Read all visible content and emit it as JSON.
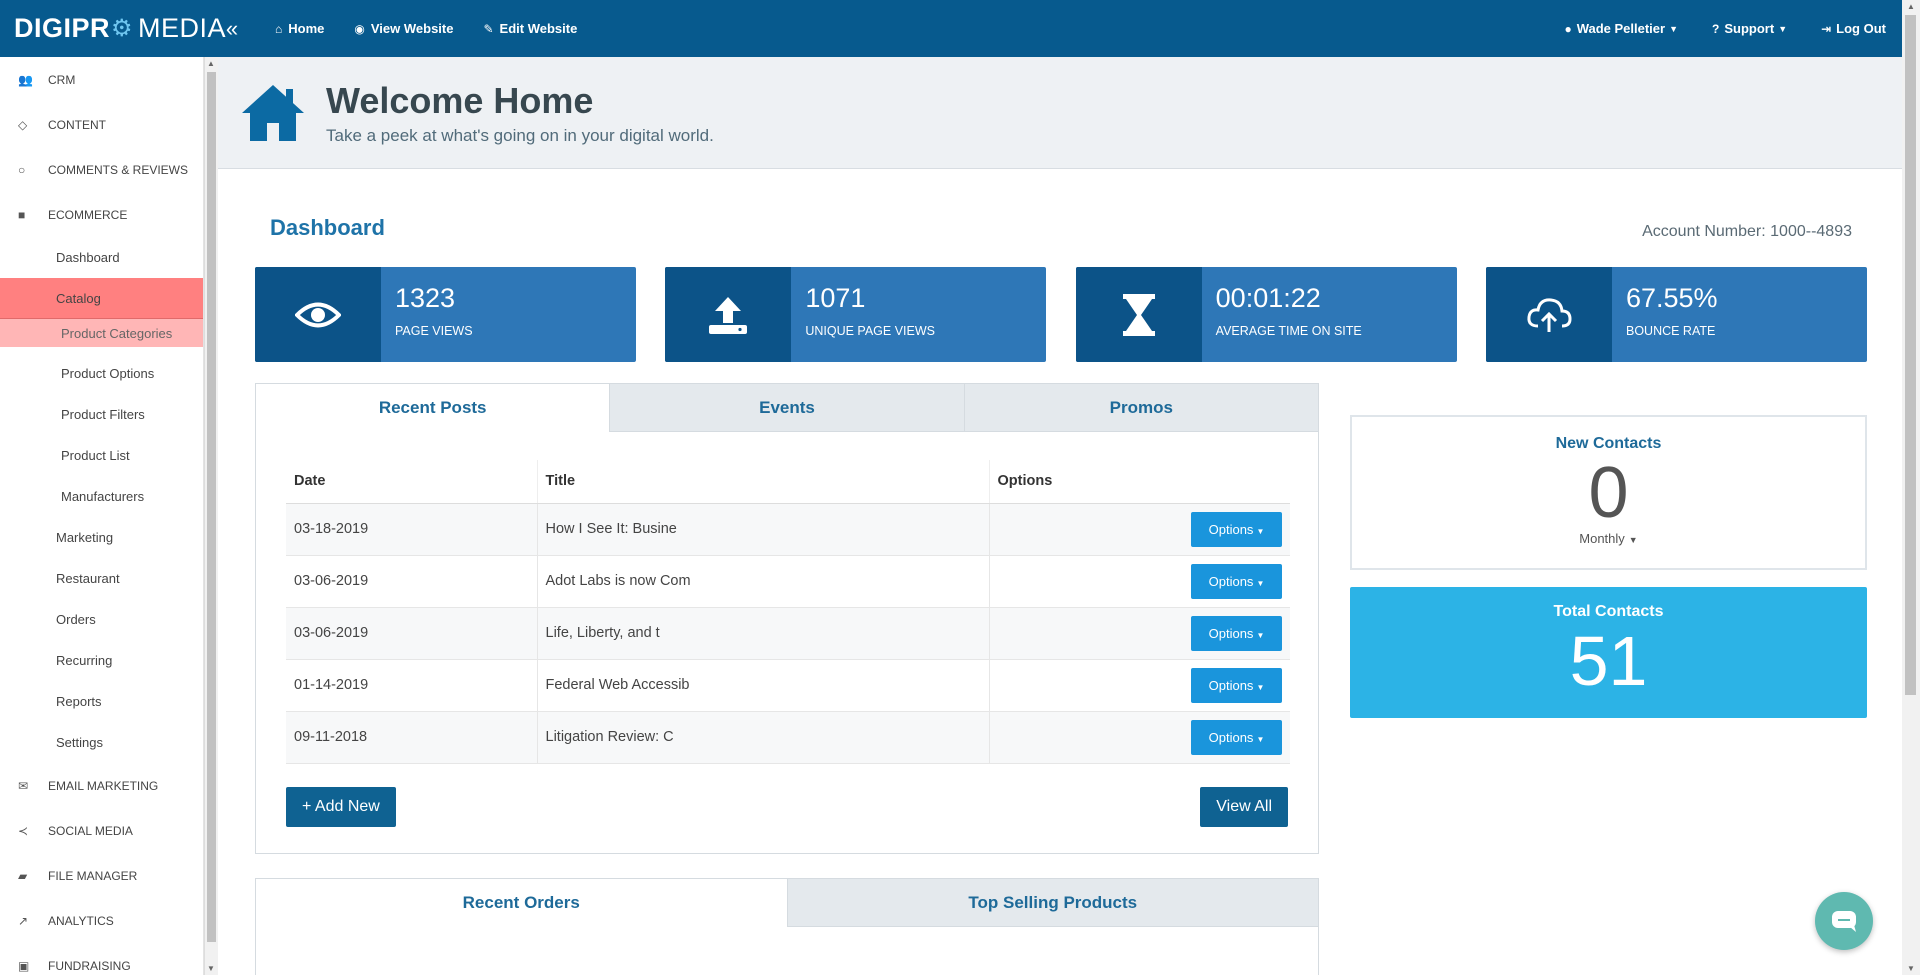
{
  "brand": {
    "part1": "DIGIPR",
    "part2": "O",
    "part3": "MEDIA"
  },
  "topnav": {
    "home": "Home",
    "view_website": "View Website",
    "edit_website": "Edit Website"
  },
  "user": {
    "name": "Wade Pelletier",
    "support": "Support",
    "logout": "Log Out"
  },
  "sidebar": {
    "crm": "CRM",
    "content": "CONTENT",
    "comments": "COMMENTS & REVIEWS",
    "ecommerce": "ECOMMERCE",
    "ecom_items": [
      "Dashboard",
      "Catalog"
    ],
    "catalog_items": [
      "Product Categories",
      "Product Options",
      "Product Filters",
      "Product List",
      "Manufacturers"
    ],
    "ecom_items2": [
      "Marketing",
      "Restaurant",
      "Orders",
      "Recurring",
      "Reports",
      "Settings"
    ],
    "email": "EMAIL MARKETING",
    "social": "SOCIAL MEDIA",
    "files": "FILE MANAGER",
    "analytics": "ANALYTICS",
    "fundraising": "FUNDRAISING"
  },
  "header": {
    "title": "Welcome Home",
    "subtitle": "Take a peek at what's going on in your digital world."
  },
  "dashboard": {
    "title": "Dashboard",
    "account": "Account Number: 1000--4893"
  },
  "stats": [
    {
      "value": "1323",
      "label": "PAGE VIEWS",
      "icon": "eye-icon"
    },
    {
      "value": "1071",
      "label": "UNIQUE PAGE VIEWS",
      "icon": "upload-icon"
    },
    {
      "value": "00:01:22",
      "label": "AVERAGE TIME ON SITE",
      "icon": "hourglass-icon"
    },
    {
      "value": "67.55%",
      "label": "BOUNCE RATE",
      "icon": "cloud-upload-icon"
    }
  ],
  "posts_panel": {
    "tabs": [
      "Recent Posts",
      "Events",
      "Promos"
    ],
    "columns": [
      "Date",
      "Title",
      "Options"
    ],
    "rows": [
      {
        "date": "03-18-2019",
        "title": "How I See It: Busine"
      },
      {
        "date": "03-06-2019",
        "title": "Adot Labs is now Com"
      },
      {
        "date": "03-06-2019",
        "title": "Life, Liberty, and t"
      },
      {
        "date": "01-14-2019",
        "title": "Federal Web Accessib"
      },
      {
        "date": "09-11-2018",
        "title": "Litigation Review: C"
      }
    ],
    "options_label": "Options",
    "add_new": "+ Add New",
    "view_all": "View All"
  },
  "orders_panel": {
    "tabs": [
      "Recent Orders",
      "Top Selling Products"
    ]
  },
  "new_contacts": {
    "title": "New Contacts",
    "value": "0",
    "period": "Monthly"
  },
  "total_contacts": {
    "title": "Total Contacts",
    "value": "51"
  },
  "colors": {
    "topbar": "#075a8e",
    "stat_bg": "#2e77b7",
    "stat_icon_bg": "#0c5388",
    "accent": "#1a95dc",
    "total_bg": "#2cb3e6",
    "active_catalog": "#ff8080"
  }
}
